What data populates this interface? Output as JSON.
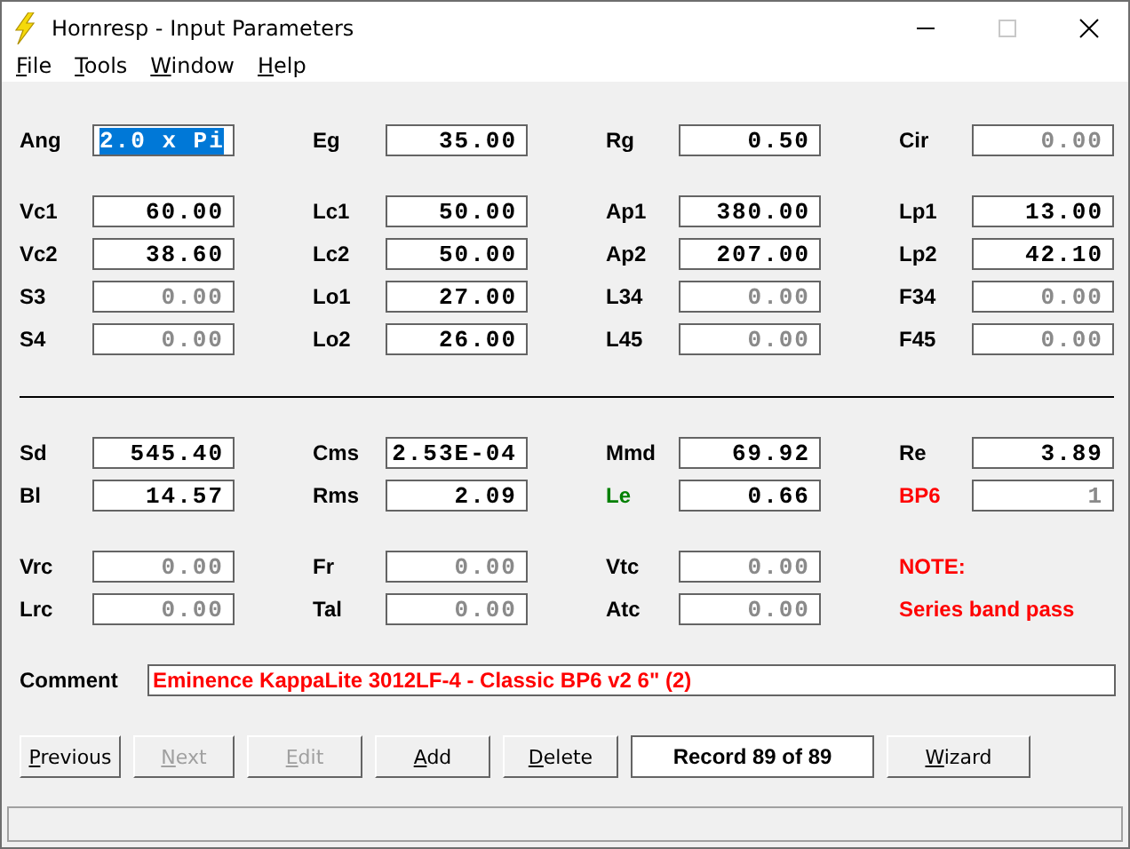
{
  "window": {
    "title": "Hornresp - Input Parameters"
  },
  "menu": [
    "File",
    "Tools",
    "Window",
    "Help"
  ],
  "upper_blocks": [
    [
      [
        {
          "kind": "param",
          "label": "Ang",
          "color": "#000000",
          "value": "2.0 x Pi",
          "dimmed": false,
          "selected": true
        },
        {
          "kind": "param",
          "label": "Eg",
          "color": "#000000",
          "value": "35.00",
          "dimmed": false,
          "selected": false
        },
        {
          "kind": "param",
          "label": "Rg",
          "color": "#000000",
          "value": "0.50",
          "dimmed": false,
          "selected": false
        },
        {
          "kind": "param",
          "label": "Cir",
          "color": "#000000",
          "value": "0.00",
          "dimmed": true,
          "selected": false
        }
      ]
    ],
    [
      [
        {
          "kind": "param",
          "label": "Vc1",
          "color": "#000000",
          "value": "60.00",
          "dimmed": false,
          "selected": false
        },
        {
          "kind": "param",
          "label": "Lc1",
          "color": "#000000",
          "value": "50.00",
          "dimmed": false,
          "selected": false
        },
        {
          "kind": "param",
          "label": "Ap1",
          "color": "#000000",
          "value": "380.00",
          "dimmed": false,
          "selected": false
        },
        {
          "kind": "param",
          "label": "Lp1",
          "color": "#000000",
          "value": "13.00",
          "dimmed": false,
          "selected": false
        }
      ],
      [
        {
          "kind": "param",
          "label": "Vc2",
          "color": "#000000",
          "value": "38.60",
          "dimmed": false,
          "selected": false
        },
        {
          "kind": "param",
          "label": "Lc2",
          "color": "#000000",
          "value": "50.00",
          "dimmed": false,
          "selected": false
        },
        {
          "kind": "param",
          "label": "Ap2",
          "color": "#000000",
          "value": "207.00",
          "dimmed": false,
          "selected": false
        },
        {
          "kind": "param",
          "label": "Lp2",
          "color": "#000000",
          "value": "42.10",
          "dimmed": false,
          "selected": false
        }
      ],
      [
        {
          "kind": "param",
          "label": "S3",
          "color": "#000000",
          "value": "0.00",
          "dimmed": true,
          "selected": false
        },
        {
          "kind": "param",
          "label": "Lo1",
          "color": "#000000",
          "value": "27.00",
          "dimmed": false,
          "selected": false
        },
        {
          "kind": "param",
          "label": "L34",
          "color": "#000000",
          "value": "0.00",
          "dimmed": true,
          "selected": false
        },
        {
          "kind": "param",
          "label": "F34",
          "color": "#000000",
          "value": "0.00",
          "dimmed": true,
          "selected": false
        }
      ],
      [
        {
          "kind": "param",
          "label": "S4",
          "color": "#000000",
          "value": "0.00",
          "dimmed": true,
          "selected": false
        },
        {
          "kind": "param",
          "label": "Lo2",
          "color": "#000000",
          "value": "26.00",
          "dimmed": false,
          "selected": false
        },
        {
          "kind": "param",
          "label": "L45",
          "color": "#000000",
          "value": "0.00",
          "dimmed": true,
          "selected": false
        },
        {
          "kind": "param",
          "label": "F45",
          "color": "#000000",
          "value": "0.00",
          "dimmed": true,
          "selected": false
        }
      ]
    ]
  ],
  "lower_blocks": [
    [
      [
        {
          "kind": "param",
          "label": "Sd",
          "color": "#000000",
          "value": "545.40",
          "dimmed": false,
          "selected": false
        },
        {
          "kind": "param",
          "label": "Cms",
          "color": "#000000",
          "value": "2.53E-04",
          "dimmed": false,
          "selected": false
        },
        {
          "kind": "param",
          "label": "Mmd",
          "color": "#000000",
          "value": "69.92",
          "dimmed": false,
          "selected": false
        },
        {
          "kind": "param",
          "label": "Re",
          "color": "#000000",
          "value": "3.89",
          "dimmed": false,
          "selected": false
        }
      ],
      [
        {
          "kind": "param",
          "label": "Bl",
          "color": "#000000",
          "value": "14.57",
          "dimmed": false,
          "selected": false
        },
        {
          "kind": "param",
          "label": "Rms",
          "color": "#000000",
          "value": "2.09",
          "dimmed": false,
          "selected": false
        },
        {
          "kind": "param",
          "label": "Le",
          "color": "#008000",
          "value": "0.66",
          "dimmed": false,
          "selected": false
        },
        {
          "kind": "param",
          "label": "BP6",
          "color": "#ff0000",
          "value": "1",
          "dimmed": true,
          "selected": false
        }
      ]
    ],
    [
      [
        {
          "kind": "param",
          "label": "Vrc",
          "color": "#000000",
          "value": "0.00",
          "dimmed": true,
          "selected": false
        },
        {
          "kind": "param",
          "label": "Fr",
          "color": "#000000",
          "value": "0.00",
          "dimmed": true,
          "selected": false
        },
        {
          "kind": "param",
          "label": "Vtc",
          "color": "#000000",
          "value": "0.00",
          "dimmed": true,
          "selected": false
        },
        {
          "kind": "note",
          "text": "NOTE:",
          "color": "#ff0000"
        }
      ],
      [
        {
          "kind": "param",
          "label": "Lrc",
          "color": "#000000",
          "value": "0.00",
          "dimmed": true,
          "selected": false
        },
        {
          "kind": "param",
          "label": "Tal",
          "color": "#000000",
          "value": "0.00",
          "dimmed": true,
          "selected": false
        },
        {
          "kind": "param",
          "label": "Atc",
          "color": "#000000",
          "value": "0.00",
          "dimmed": true,
          "selected": false
        },
        {
          "kind": "note",
          "text": "Series band pass",
          "color": "#ff0000"
        }
      ]
    ]
  ],
  "comment": {
    "label": "Comment",
    "value": "Eminence KappaLite 3012LF-4 - Classic BP6 v2 6\" (2)"
  },
  "buttons": [
    {
      "kind": "button",
      "label": "Previous",
      "disabled": false
    },
    {
      "kind": "button",
      "label": "Next",
      "disabled": true
    },
    {
      "kind": "button",
      "label": "Edit",
      "disabled": true
    },
    {
      "kind": "button",
      "label": "Add",
      "disabled": false
    },
    {
      "kind": "button",
      "label": "Delete",
      "disabled": false
    },
    {
      "kind": "display",
      "label": "Record 89 of 89"
    },
    {
      "kind": "button",
      "label": "Wizard",
      "disabled": false
    }
  ]
}
